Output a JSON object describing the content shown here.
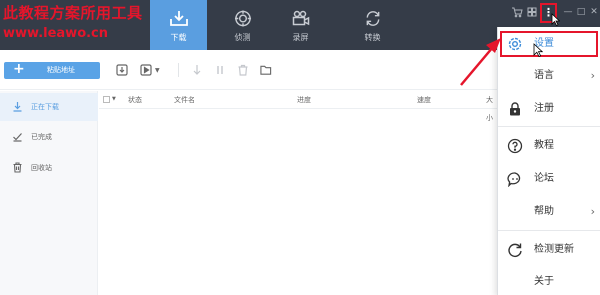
{
  "watermark": {
    "title": "此教程方案所用工具",
    "url": "www.leawo.cn"
  },
  "nav": {
    "tabs": [
      {
        "label": "下载",
        "icon": "download-tray-icon"
      },
      {
        "label": "侦测",
        "icon": "target-icon"
      },
      {
        "label": "录屏",
        "icon": "video-camera-icon"
      },
      {
        "label": "转换",
        "icon": "refresh-icon"
      }
    ],
    "active_tab": "下载"
  },
  "window_controls": {
    "menu_glyph": "⋮",
    "minimize_glyph": "—",
    "maximize_glyph": "□",
    "close_glyph": "✕"
  },
  "toolbar": {
    "paste_plus": "+",
    "paste_label": "粘贴地址"
  },
  "sidebar": {
    "items": [
      {
        "label": "正在下载",
        "icon": "download-icon"
      },
      {
        "label": "已完成",
        "icon": "check-icon"
      },
      {
        "label": "回收站",
        "icon": "trash-icon"
      }
    ]
  },
  "table": {
    "columns": [
      "状态",
      "文件名",
      "进度",
      "速度",
      "大小"
    ]
  },
  "menu": {
    "items": [
      {
        "label": "设置",
        "icon": "gear-icon",
        "submenu": false,
        "highlighted": true
      },
      {
        "label": "语言",
        "icon": "",
        "submenu": true
      },
      {
        "label": "注册",
        "icon": "lock-icon",
        "submenu": false
      },
      {
        "label": "教程",
        "icon": "help-circle-icon",
        "submenu": false
      },
      {
        "label": "论坛",
        "icon": "chat-bubble-icon",
        "submenu": false
      },
      {
        "label": "帮助",
        "icon": "",
        "submenu": true
      },
      {
        "label": "检测更新",
        "icon": "refresh-icon",
        "submenu": false
      },
      {
        "label": "关于",
        "icon": "",
        "submenu": false
      }
    ],
    "arrow_glyph": "›"
  },
  "colors": {
    "topbar": "#353c48",
    "accent": "#5a9ee0",
    "annotation_red": "#e5152b",
    "sidebar_bg": "#f7f8fa"
  }
}
